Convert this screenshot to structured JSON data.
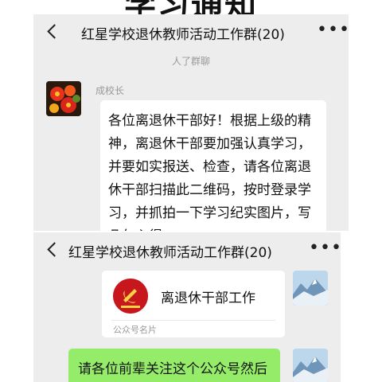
{
  "page": {
    "heading": "学习通知"
  },
  "chat1": {
    "title": "红星学校退休教师活动工作群(20)",
    "more": "•••",
    "system_notice": "人了群聊",
    "sender": "成校长",
    "message": "各位离退休干部好！根据上级的精神，离退休干部要加强认真学习，并要如实报送、检查，请各位离退休干部扫描此二维码，按时登录学习，并抓拍一下学习纪实图片，写几句心得"
  },
  "chat2": {
    "title": "红星学校退休教师活动工作群(20)",
    "more": "•••",
    "card": {
      "name": "离退休干部工作",
      "label": "公众号名片"
    },
    "message": "请各位前辈关注这个公众号然后点击学习专栏"
  },
  "colors": {
    "chat_bg": "#ededed",
    "self_bubble": "#95ec69",
    "badge_red": "#c8161d"
  },
  "icons": {
    "back": "chevron-left-icon",
    "more": "more-dots-icon"
  }
}
